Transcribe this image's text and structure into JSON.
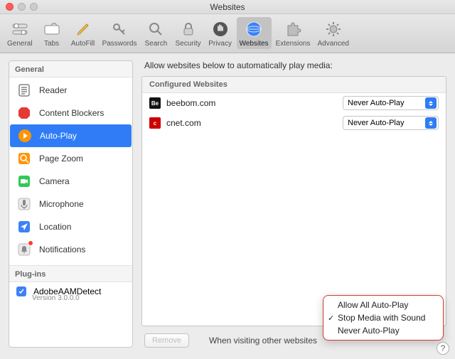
{
  "window": {
    "title": "Websites"
  },
  "toolbar": {
    "items": [
      {
        "label": "General"
      },
      {
        "label": "Tabs"
      },
      {
        "label": "AutoFill"
      },
      {
        "label": "Passwords"
      },
      {
        "label": "Search"
      },
      {
        "label": "Security"
      },
      {
        "label": "Privacy"
      },
      {
        "label": "Websites"
      },
      {
        "label": "Extensions"
      },
      {
        "label": "Advanced"
      }
    ]
  },
  "sidebar": {
    "section_general": "General",
    "items": [
      {
        "label": "Reader"
      },
      {
        "label": "Content Blockers"
      },
      {
        "label": "Auto-Play"
      },
      {
        "label": "Page Zoom"
      },
      {
        "label": "Camera"
      },
      {
        "label": "Microphone"
      },
      {
        "label": "Location"
      },
      {
        "label": "Notifications"
      }
    ],
    "section_plugins": "Plug-ins",
    "plugin": {
      "name": "AdobeAAMDetect",
      "version": "Version 3.0.0.0"
    }
  },
  "content": {
    "header": "Allow websites below to automatically play media:",
    "panel_header": "Configured Websites",
    "sites": [
      {
        "name": "beebom.com",
        "policy": "Never Auto-Play"
      },
      {
        "name": "cnet.com",
        "policy": "Never Auto-Play"
      }
    ],
    "remove_label": "Remove",
    "footer_label": "When visiting other websites"
  },
  "popover": {
    "options": [
      {
        "label": "Allow All Auto-Play",
        "checked": false
      },
      {
        "label": "Stop Media with Sound",
        "checked": true
      },
      {
        "label": "Never Auto-Play",
        "checked": false
      }
    ]
  }
}
